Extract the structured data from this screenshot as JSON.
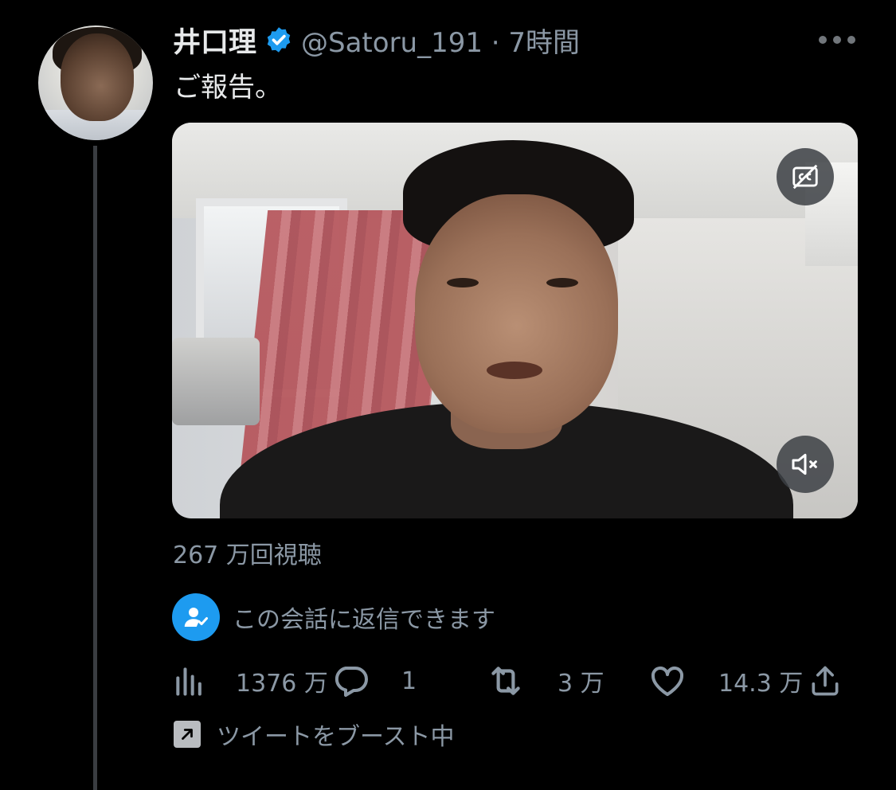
{
  "tweet": {
    "display_name": "井口理",
    "handle_time": "@Satoru_191 · 7時間",
    "text": "ご報告。",
    "verified_color": "#1d9bf0"
  },
  "video": {
    "views": "267 万回視聴",
    "captions_icon": "captions-off-icon",
    "volume_icon": "volume-muted-icon"
  },
  "reply_permission": {
    "text": "この会話に返信できます",
    "icon": "user-check-icon",
    "icon_bg": "#1d9bf0"
  },
  "actions": {
    "views": "1376 万",
    "replies": "1",
    "retweets": "3 万",
    "likes": "14.3 万"
  },
  "boost": {
    "text": "ツイートをブースト中"
  },
  "colors": {
    "background": "#000000",
    "text_primary": "#e7e9ea",
    "text_secondary": "#8b98a5",
    "accent": "#1d9bf0"
  }
}
